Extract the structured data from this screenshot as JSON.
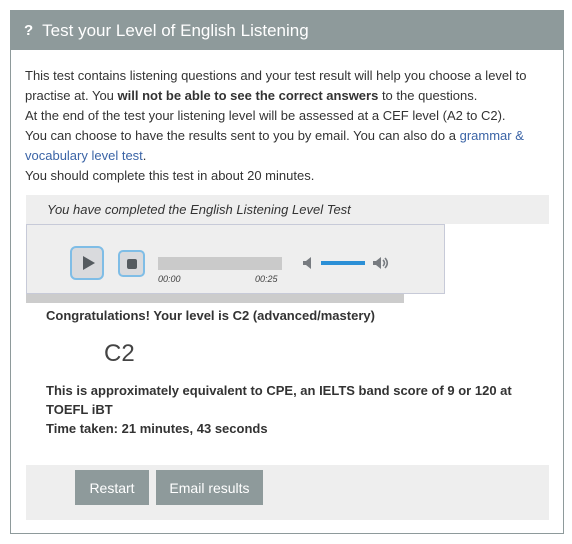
{
  "panel": {
    "icon": "question-icon",
    "icon_glyph": "?",
    "title": "Test your Level of English Listening"
  },
  "intro": {
    "line1": "This test contains listening questions and your test result will help you choose a level to practise at. You ",
    "bold_text": "will not be able to see the correct answers",
    "line1_end": " to the questions.",
    "line2": "At the end of the test your listening level will be assessed at a CEF level (A2 to C2).",
    "line3_start": "You can choose to have the results sent to you by email. You can also do a ",
    "link_text": "grammar & vocabulary level test",
    "line3_end": ".",
    "line4": "You should complete this test in about 20 minutes."
  },
  "player": {
    "completed_text": "You have completed the English Listening Level Test",
    "time_current": "00:00",
    "time_total": "00:25",
    "volume_level": 1.0
  },
  "result": {
    "congrats": "Congratulations! Your level is C2 (advanced/mastery)",
    "level": "C2",
    "equivalent": "This is approximately equivalent to CPE, an IELTS band score of 9 or 120 at TOEFL iBT",
    "time_taken": "Time taken: 21 minutes, 43 seconds"
  },
  "actions": {
    "restart_label": "Restart",
    "email_label": "Email results"
  },
  "colors": {
    "header_bg": "#8e9a9b",
    "link": "#3b64a6",
    "focus_ring": "#7fbde6",
    "volume": "#2b8fd6"
  }
}
